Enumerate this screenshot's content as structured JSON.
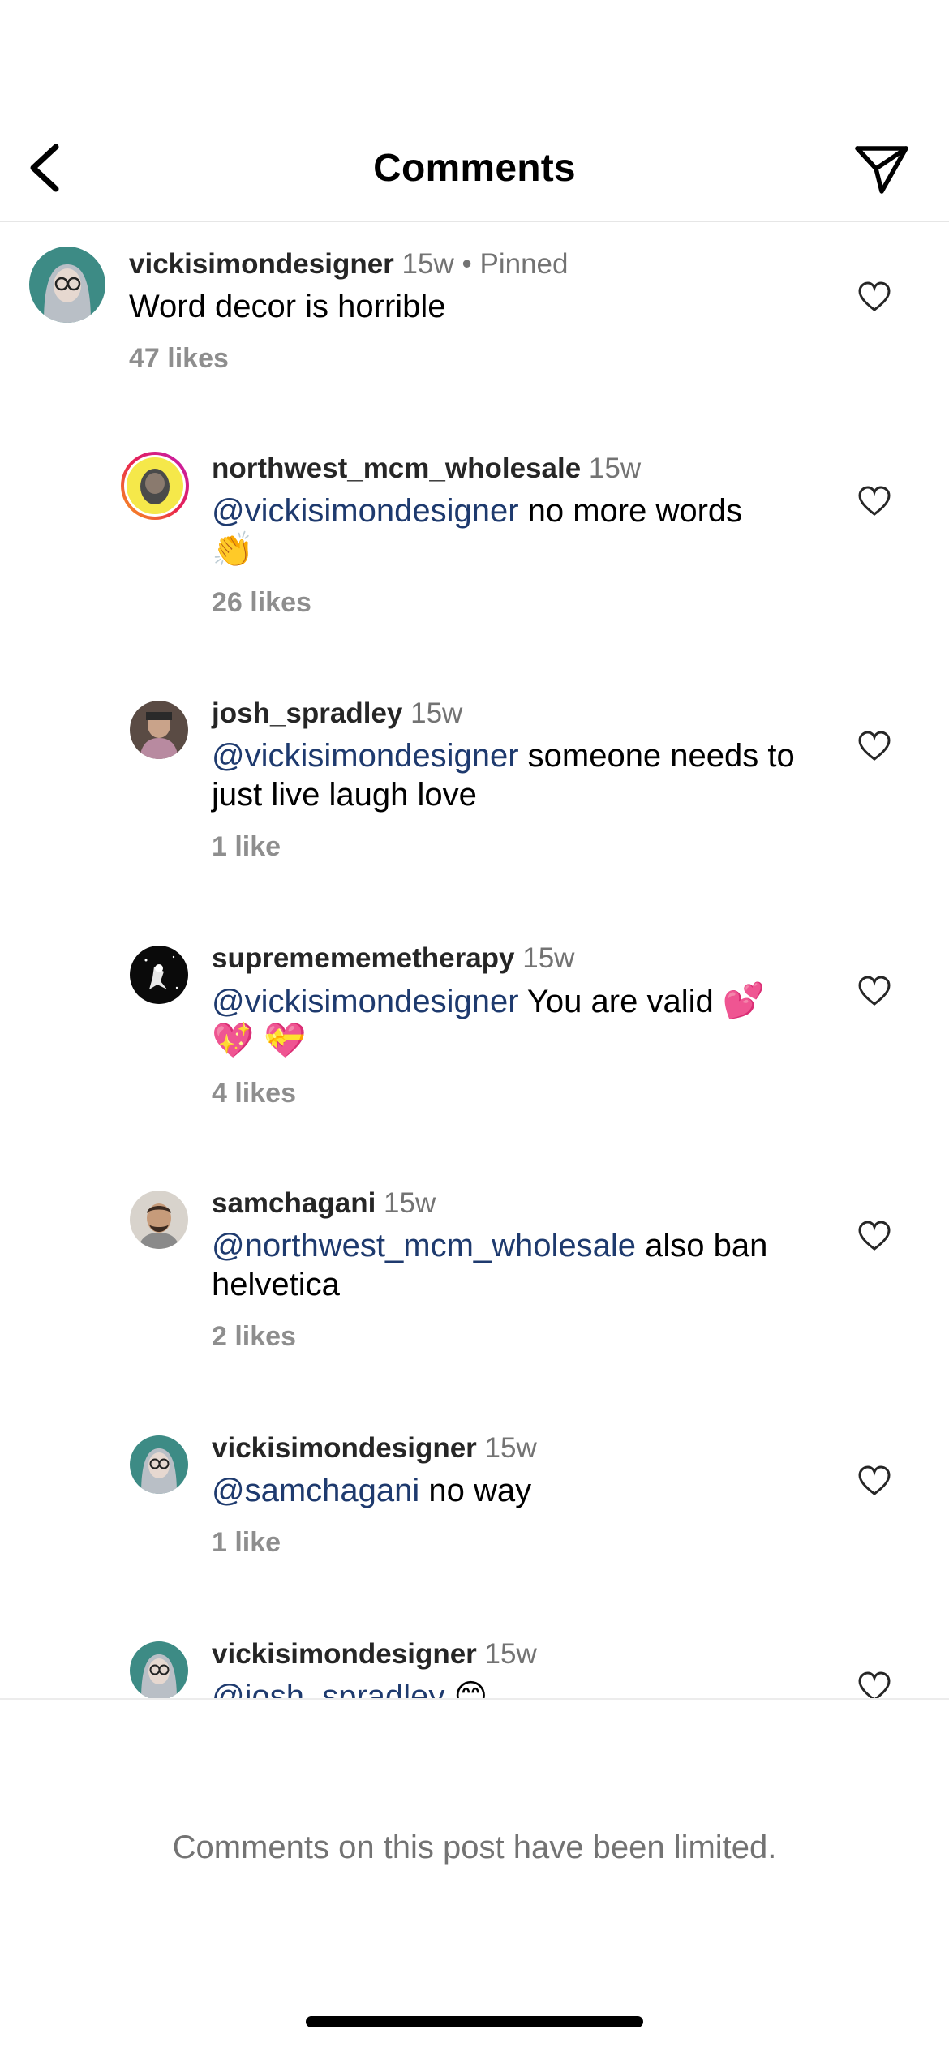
{
  "header": {
    "title": "Comments",
    "back_icon": "chevron-left-icon",
    "share_icon": "paper-plane-icon"
  },
  "comments": [
    {
      "username": "vickisimondesigner",
      "time": "15w",
      "separator": "•",
      "pinned": "Pinned",
      "mention": "",
      "text": "Word decor is horrible",
      "likes": "47 likes"
    },
    {
      "username": "northwest_mcm_wholesale",
      "time": "15w",
      "mention": "@vickisimondesigner",
      "text": " no more words",
      "emoji": "👏",
      "likes": "26 likes"
    },
    {
      "username": "josh_spradley",
      "time": "15w",
      "mention": "@vickisimondesigner",
      "text": " someone needs to just live laugh love",
      "likes": "1 like"
    },
    {
      "username": "suprememe​metherapy",
      "time": "15w",
      "mention": "@vickisimondesigner",
      "text": " You are valid",
      "emoji": "💕 💖 💝",
      "likes": "4 likes"
    },
    {
      "username": "samchagani",
      "time": "15w",
      "mention": "@northwest_mcm_wholesale",
      "text": " also ban helvetica",
      "likes": "2 likes"
    },
    {
      "username": "vickisimondesigner",
      "time": "15w",
      "mention": "@samchagani",
      "text": " no way",
      "likes": "1 like"
    },
    {
      "username": "vickisimondesigner",
      "time": "15w",
      "mention": "@josh_spradley",
      "text": " 😊",
      "likes": ""
    }
  ],
  "footer": {
    "notice": "Comments on this post have been limited."
  },
  "colors": {
    "mention": "#1e3a6e",
    "muted": "#737373",
    "likes": "#8e8e8e"
  }
}
